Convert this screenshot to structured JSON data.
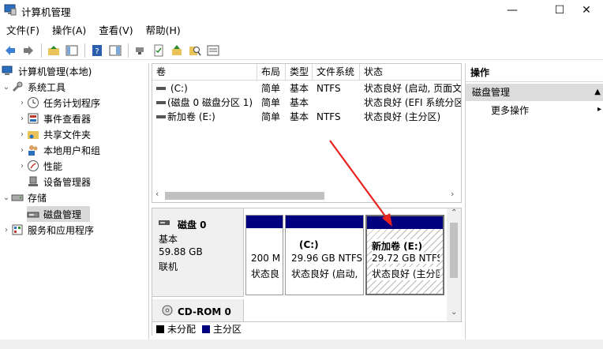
{
  "window": {
    "title": "计算机管理",
    "minimize": "—",
    "maximize": "☐",
    "close": "✕"
  },
  "menu": [
    "文件(F)",
    "操作(A)",
    "查看(V)",
    "帮助(H)"
  ],
  "tree": {
    "root": "计算机管理(本地)",
    "system_tools": "系统工具",
    "task_scheduler": "任务计划程序",
    "event_viewer": "事件查看器",
    "shared_folders": "共享文件夹",
    "local_users": "本地用户和组",
    "performance": "性能",
    "device_manager": "设备管理器",
    "storage": "存储",
    "disk_management": "磁盘管理",
    "services_apps": "服务和应用程序"
  },
  "volume_table": {
    "headers": [
      "卷",
      "布局",
      "类型",
      "文件系统",
      "状态"
    ],
    "rows": [
      [
        "(C:)",
        "简单",
        "基本",
        "NTFS",
        "状态良好 (启动, 页面文"
      ],
      [
        "(磁盘 0 磁盘分区 1)",
        "简单",
        "基本",
        "",
        "状态良好 (EFI 系统分区"
      ],
      [
        "新加卷 (E:)",
        "简单",
        "基本",
        "NTFS",
        "状态良好 (主分区)"
      ]
    ]
  },
  "disk0": {
    "name": "磁盘 0",
    "type": "基本",
    "size": "59.88 GB",
    "status": "联机",
    "partitions": [
      {
        "line1": "",
        "line2": "200 M",
        "line3": "状态良"
      },
      {
        "line1": "(C:)",
        "line2": "29.96 GB NTFS",
        "line3": "状态良好 (启动,"
      },
      {
        "line1": "新加卷  (E:)",
        "line2": "29.72 GB NTFS",
        "line3": "状态良好 (主分区"
      }
    ]
  },
  "cdrom": {
    "name": "CD-ROM 0"
  },
  "legend": {
    "unallocated": "未分配",
    "primary": "主分区"
  },
  "actions": {
    "header": "操作",
    "section": "磁盘管理",
    "more": "更多操作"
  },
  "colors": {
    "partition_bar": "#00007f",
    "annotation_arrow": "#e8231f"
  }
}
